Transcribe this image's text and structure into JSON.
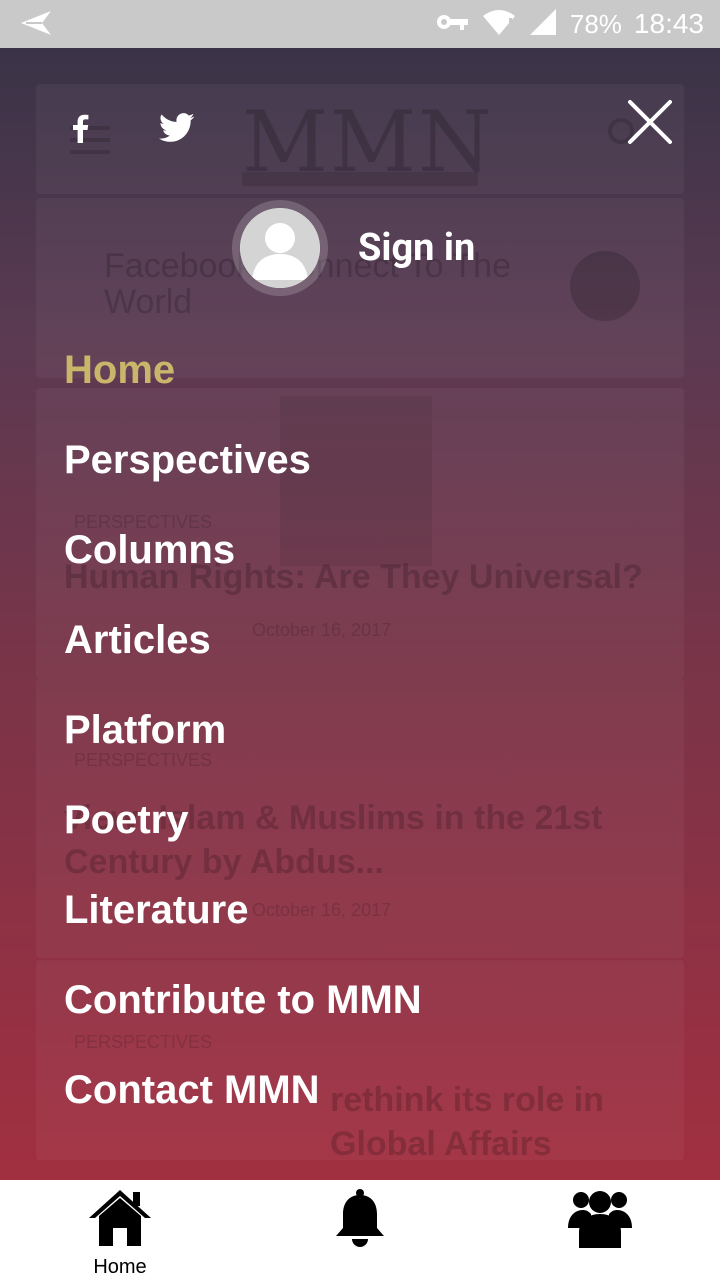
{
  "status_bar": {
    "battery": "78%",
    "time": "18:43",
    "icons": [
      "send-icon",
      "vpn-key-icon",
      "wifi-icon",
      "signal-icon"
    ]
  },
  "background": {
    "logo": "MMN",
    "card1_title": "Facebook: Connect To The World",
    "card2_tag": "PERSPECTIVES",
    "card2_title": "Human Rights: Are They Universal?",
    "card2_date": "October 16, 2017",
    "card3_tag": "PERSPECTIVES",
    "card3_title": "view: Islam & Muslims in the 21st Century by Abdus...",
    "card3_date": "October 16, 2017",
    "card4_tag": "PERSPECTIVES",
    "card4_title": "rethink its role in Global Affairs"
  },
  "drawer": {
    "social": [
      "facebook-icon",
      "twitter-icon"
    ],
    "sign_in": "Sign in",
    "menu": [
      {
        "label": "Home",
        "active": true
      },
      {
        "label": "Perspectives",
        "active": false
      },
      {
        "label": "Columns",
        "active": false
      },
      {
        "label": "Articles",
        "active": false
      },
      {
        "label": "Platform",
        "active": false
      },
      {
        "label": "Poetry",
        "active": false
      },
      {
        "label": "Literature",
        "active": false
      },
      {
        "label": "Contribute to MMN",
        "active": false
      },
      {
        "label": "Contact MMN",
        "active": false
      }
    ],
    "active_color": "#c9b66a"
  },
  "bottom_nav": {
    "items": [
      {
        "icon": "home-icon",
        "label": "Home"
      },
      {
        "icon": "bell-icon",
        "label": ""
      },
      {
        "icon": "group-icon",
        "label": ""
      }
    ]
  }
}
